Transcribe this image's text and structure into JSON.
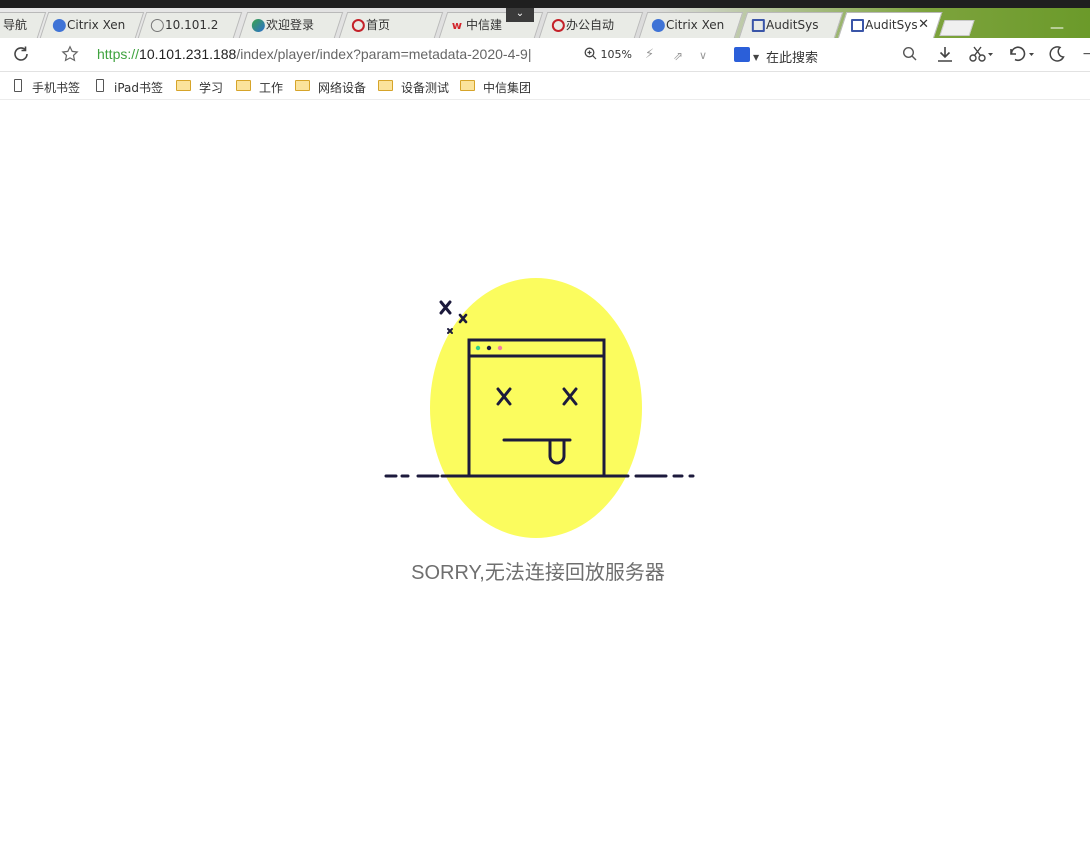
{
  "tabs": [
    {
      "label": "导航",
      "icon": "none"
    },
    {
      "label": "Citrix Xen",
      "icon": "citrix-icon"
    },
    {
      "label": "10.101.2",
      "icon": "globe-icon"
    },
    {
      "label": "欢迎登录",
      "icon": "globe-color-icon"
    },
    {
      "label": "首页",
      "icon": "citic-logo-icon"
    },
    {
      "label": "中信建",
      "icon": "w-logo-icon"
    },
    {
      "label": "办公自动",
      "icon": "citic-logo-icon"
    },
    {
      "label": "Citrix Xen",
      "icon": "citrix-icon"
    },
    {
      "label": "AuditSys",
      "icon": "auditsys-icon"
    },
    {
      "label": "AuditSys",
      "icon": "auditsys-icon",
      "active": true
    }
  ],
  "tab_menu_glyph": "⌄",
  "window_min_glyph": "—",
  "address": {
    "scheme": "https://",
    "host": "10.101.231.188",
    "path": "/index/player/index?param=metadata-2020-4-9|",
    "zoom": "105%",
    "search_placeholder": "在此搜索"
  },
  "bookmarks": [
    {
      "label": "手机书签",
      "icon": "device-icon"
    },
    {
      "label": "iPad书签",
      "icon": "device-icon"
    },
    {
      "label": "学习",
      "icon": "folder-icon"
    },
    {
      "label": "工作",
      "icon": "folder-icon"
    },
    {
      "label": "网络设备",
      "icon": "folder-icon"
    },
    {
      "label": "设备测试",
      "icon": "folder-icon"
    },
    {
      "label": "中信集团",
      "icon": "folder-icon"
    }
  ],
  "error_message": "SORRY,无法连接回放服务器",
  "colors": {
    "illustration_yellow": "#fbfc5e",
    "illustration_line": "#1c1a3c",
    "url_scheme": "#3fa33f",
    "tabbar_accent": "#6b9a2a"
  }
}
